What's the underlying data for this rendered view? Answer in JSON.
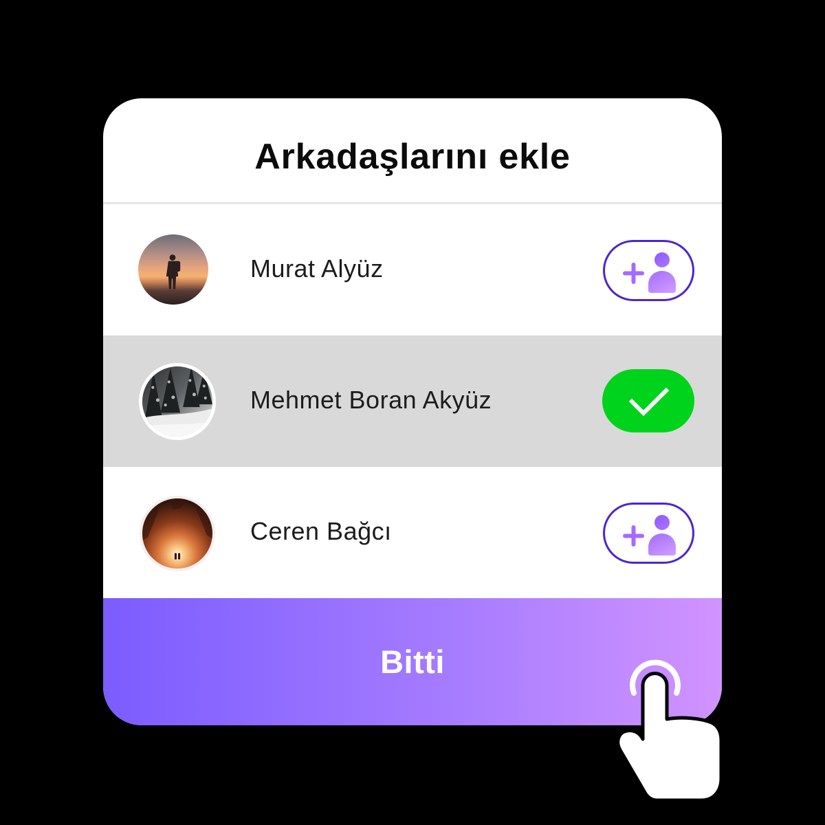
{
  "header": {
    "title": "Arkadaşlarını ekle"
  },
  "friends": [
    {
      "name": "Murat Alyüz",
      "added": false,
      "action_icon": "add-friend-icon"
    },
    {
      "name": "Mehmet Boran Akyüz",
      "added": true,
      "action_icon": "checkmark-icon"
    },
    {
      "name": "Ceren Bağcı",
      "added": false,
      "action_icon": "add-friend-icon"
    }
  ],
  "footer": {
    "done_label": "Bitti",
    "pointer_icon": "tap-hand-icon"
  },
  "colors": {
    "page_background": "#000000",
    "card_background": "#ffffff",
    "divider": "#e4e4e4",
    "selected_row": "#d9d9d9",
    "text": "#1c1c1c",
    "add_button_border": "#4a25d4",
    "add_icon_start": "#8a55ff",
    "add_icon_end": "#d59fff",
    "add_icon_plus": "#a46bff",
    "added_button": "#00d31b",
    "done_gradient_start": "#7b5cff",
    "done_gradient_end": "#d193ff"
  }
}
